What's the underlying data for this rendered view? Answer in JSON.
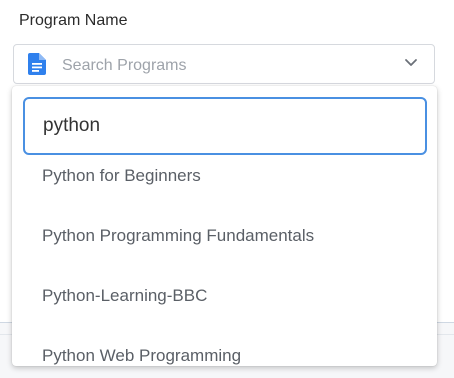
{
  "field": {
    "label": "Program Name",
    "placeholder": "Search Programs",
    "icon": "document-icon",
    "chevron_icon": "chevron-down-icon"
  },
  "dropdown": {
    "search_value": "python",
    "options": [
      {
        "label": "Python for Beginners"
      },
      {
        "label": "Python Programming Fundamentals"
      },
      {
        "label": "Python-Learning-BBC"
      },
      {
        "label": "Python Web Programming"
      }
    ]
  },
  "colors": {
    "accent": "#4a90e2",
    "icon_blue": "#2f80ed"
  }
}
